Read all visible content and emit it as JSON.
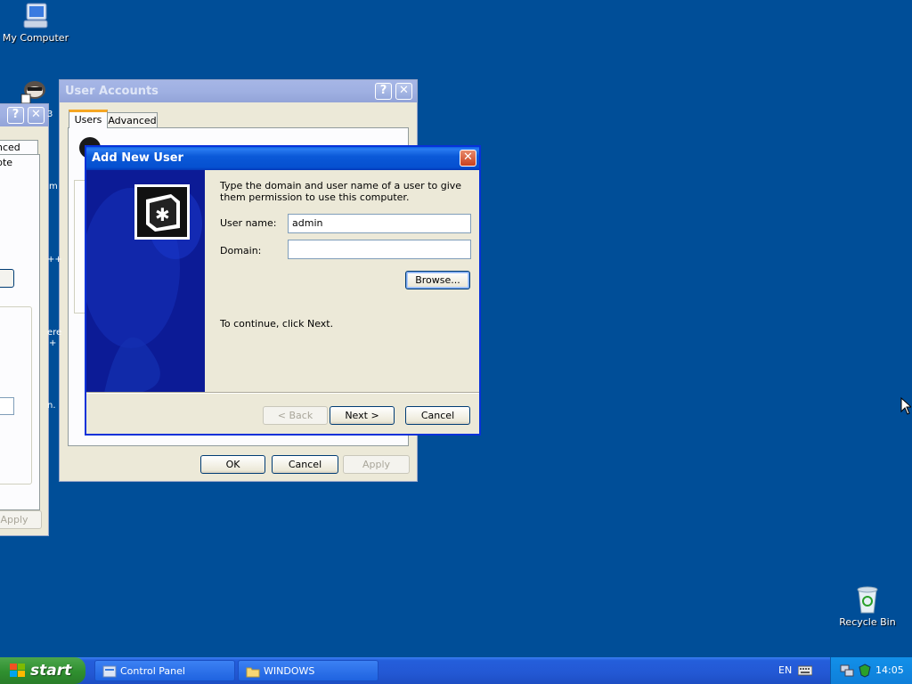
{
  "desktop": {
    "my_computer": "My Computer",
    "recycle_bin": "Recycle Bin"
  },
  "left_window": {
    "tab_partial": "nced",
    "text_partial": "pte",
    "apply_label": "Apply"
  },
  "user_accounts": {
    "title": "User Accounts",
    "tabs": [
      "Users",
      "Advanced"
    ],
    "side_fragments": [
      "3",
      "m",
      "++",
      "ere",
      "+",
      "n."
    ],
    "buttons": {
      "ok": "OK",
      "cancel": "Cancel",
      "apply": "Apply"
    }
  },
  "dialog": {
    "title": "Add New User",
    "instruction": "Type the domain and user name of a user to give them permission to use this computer.",
    "user_name_label": "User name:",
    "user_name_value": "admin",
    "domain_label": "Domain:",
    "domain_value": "",
    "browse_label": "Browse...",
    "continue_text": "To continue, click Next.",
    "back_label": "< Back",
    "next_label": "Next >",
    "cancel_label": "Cancel"
  },
  "taskbar": {
    "start_label": "start",
    "tasks": [
      "Control Panel",
      "WINDOWS"
    ],
    "language": "EN",
    "clock": "14:05"
  },
  "colors": {
    "desktop": "#004e98",
    "title_active": "#0b59d8",
    "dialog_art": "#0a1a9a"
  }
}
